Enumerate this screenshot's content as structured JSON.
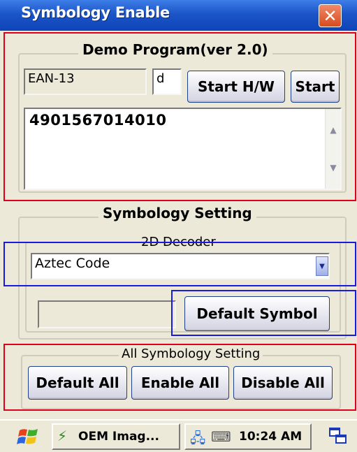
{
  "window": {
    "title": "Symbology Enable",
    "close_glyph": "✕"
  },
  "demo": {
    "group_label": "Demo Program(ver 2.0)",
    "symbology_value": "EAN-13",
    "code_value": "d",
    "start_hw_label": "Start H/W",
    "start_label": "Start",
    "scan_result": "4901567014010"
  },
  "symbology_setting": {
    "group_label": "Symbology Setting",
    "decoder_label": "2D Decoder",
    "decoder_selected": "Aztec Code",
    "status_value": "",
    "default_symbol_label": "Default Symbol"
  },
  "all_setting": {
    "group_label": "All Symbology Setting",
    "default_all_label": "Default All",
    "enable_all_label": "Enable All",
    "disable_all_label": "Disable All"
  },
  "taskbar": {
    "start_icon": "windows-flag-icon",
    "app_button_label": "OEM Imag...",
    "clock": "10:24 AM",
    "tray_icons": [
      "network-icon",
      "keyboard-icon"
    ],
    "desktop_icon": "show-desktop-icon"
  },
  "colors": {
    "title_bar": "#1c55c7",
    "annotation_red": "#e0001b",
    "annotation_blue": "#1a1adc",
    "dialog_bg": "#ece9d8"
  }
}
